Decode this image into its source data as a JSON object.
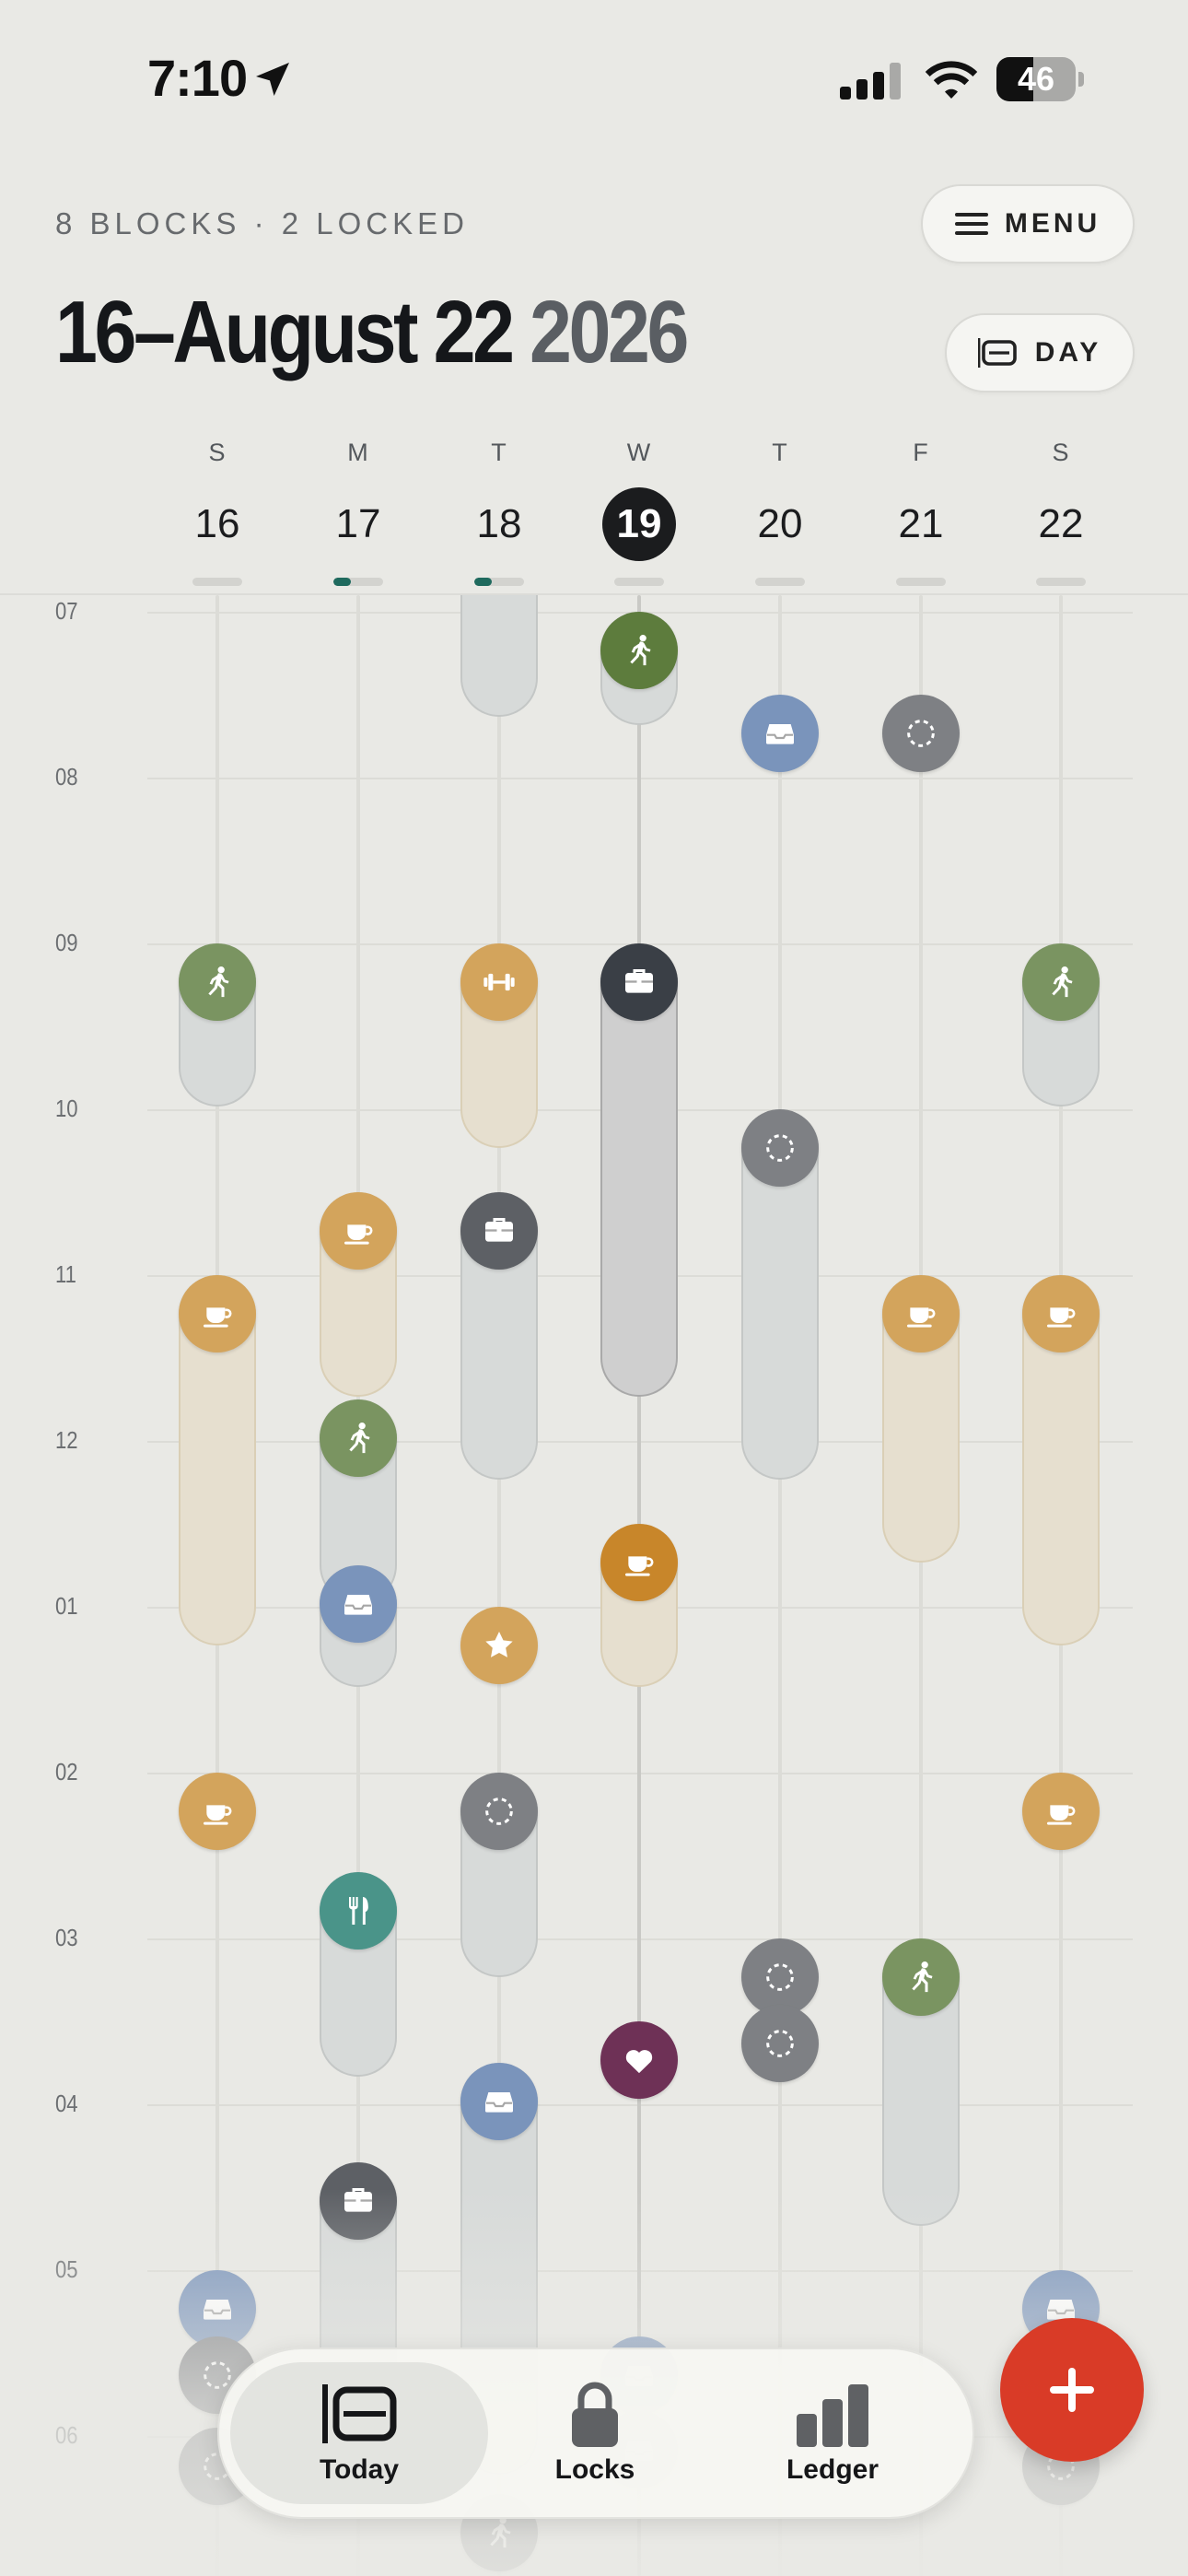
{
  "status_bar": {
    "time": "7:10",
    "battery": "46",
    "battery_level": 0.46
  },
  "header": {
    "subtitle": "8 BLOCKS · 2 LOCKED",
    "title_range": "16–August 22",
    "title_year": "2026",
    "menu_label": "MENU",
    "view_label": "DAY"
  },
  "week": {
    "days": [
      {
        "dow": "S",
        "num": "16",
        "progress": 0
      },
      {
        "dow": "M",
        "num": "17",
        "progress": 0.35
      },
      {
        "dow": "T",
        "num": "18",
        "progress": 0.35
      },
      {
        "dow": "W",
        "num": "19",
        "progress": 0,
        "active": true
      },
      {
        "dow": "T",
        "num": "20",
        "progress": 0
      },
      {
        "dow": "F",
        "num": "21",
        "progress": 0
      },
      {
        "dow": "S",
        "num": "22",
        "progress": 0
      }
    ]
  },
  "timeline": {
    "hours": [
      "07",
      "08",
      "09",
      "10",
      "11",
      "12",
      "01",
      "02",
      "03",
      "04",
      "05",
      "06"
    ],
    "blocks": [
      {
        "day": 2,
        "start": 6.6,
        "end": 7.4,
        "color": "gray",
        "icon": null
      },
      {
        "day": 3,
        "start": 7.0,
        "end": 7.45,
        "color": "green-d",
        "icon": "runner-icon"
      },
      {
        "day": 4,
        "start": 7.5,
        "end": 7.5,
        "color": "blue",
        "icon": "inbox-icon"
      },
      {
        "day": 5,
        "start": 7.5,
        "end": 7.5,
        "color": "gray",
        "icon": "dashed-circle-icon"
      },
      {
        "day": 0,
        "start": 9.0,
        "end": 9.75,
        "color": "green",
        "icon": "runner-icon"
      },
      {
        "day": 2,
        "start": 9.0,
        "end": 10.0,
        "color": "orange",
        "icon": "dumbbell-icon"
      },
      {
        "day": 3,
        "start": 9.0,
        "end": 11.5,
        "color": "navy",
        "icon": "briefcase-icon",
        "dark": true
      },
      {
        "day": 6,
        "start": 9.0,
        "end": 9.75,
        "color": "green",
        "icon": "runner-icon"
      },
      {
        "day": 4,
        "start": 10.0,
        "end": 12.0,
        "color": "gray",
        "icon": "dashed-circle-icon"
      },
      {
        "day": 1,
        "start": 10.5,
        "end": 11.5,
        "color": "orange",
        "icon": "coffee-icon"
      },
      {
        "day": 2,
        "start": 10.5,
        "end": 12.0,
        "color": "slate",
        "icon": "briefcase-icon"
      },
      {
        "day": 0,
        "start": 11.0,
        "end": 13.0,
        "color": "orange",
        "icon": "coffee-icon"
      },
      {
        "day": 5,
        "start": 11.0,
        "end": 12.5,
        "color": "orange",
        "icon": "coffee-icon"
      },
      {
        "day": 6,
        "start": 11.0,
        "end": 13.0,
        "color": "orange",
        "icon": "coffee-icon"
      },
      {
        "day": 1,
        "start": 11.75,
        "end": 12.75,
        "color": "green",
        "icon": "runner-icon"
      },
      {
        "day": 3,
        "start": 12.5,
        "end": 13.25,
        "color": "orange-d",
        "icon": "coffee-icon"
      },
      {
        "day": 1,
        "start": 12.75,
        "end": 13.25,
        "color": "blue",
        "icon": "inbox-icon"
      },
      {
        "day": 2,
        "start": 13.0,
        "end": 13.0,
        "color": "orange",
        "icon": "star-icon"
      },
      {
        "day": 0,
        "start": 14.0,
        "end": 14.0,
        "color": "orange",
        "icon": "coffee-icon"
      },
      {
        "day": 2,
        "start": 14.0,
        "end": 15.0,
        "color": "gray",
        "icon": "dashed-circle-icon"
      },
      {
        "day": 6,
        "start": 14.0,
        "end": 14.0,
        "color": "orange",
        "icon": "coffee-icon"
      },
      {
        "day": 1,
        "start": 14.6,
        "end": 15.6,
        "color": "teal",
        "icon": "utensils-icon"
      },
      {
        "day": 4,
        "start": 15.0,
        "end": 15.0,
        "color": "gray",
        "icon": "dashed-circle-icon"
      },
      {
        "day": 5,
        "start": 15.0,
        "end": 16.5,
        "color": "green",
        "icon": "runner-icon"
      },
      {
        "day": 4,
        "start": 15.4,
        "end": 15.4,
        "color": "gray",
        "icon": "dashed-circle-icon"
      },
      {
        "day": 3,
        "start": 15.5,
        "end": 15.5,
        "color": "plum",
        "icon": "heart-icon"
      },
      {
        "day": 2,
        "start": 15.75,
        "end": 18.0,
        "color": "blue",
        "icon": "inbox-icon"
      },
      {
        "day": 1,
        "start": 16.35,
        "end": 18.0,
        "color": "slate",
        "icon": "briefcase-icon"
      },
      {
        "day": 0,
        "start": 17.0,
        "end": 17.0,
        "color": "blue",
        "icon": "inbox-icon"
      },
      {
        "day": 6,
        "start": 17.0,
        "end": 17.0,
        "color": "blue",
        "icon": "inbox-icon"
      },
      {
        "day": 0,
        "start": 17.4,
        "end": 17.4,
        "color": "gray",
        "icon": "dashed-circle-icon"
      },
      {
        "day": 3,
        "start": 17.4,
        "end": 17.4,
        "color": "blue",
        "icon": "inbox-icon"
      },
      {
        "day": 0,
        "start": 17.95,
        "end": 17.95,
        "color": "gray",
        "icon": "dashed-circle-icon"
      },
      {
        "day": 6,
        "start": 17.95,
        "end": 17.95,
        "color": "gray",
        "icon": "dashed-circle-icon"
      },
      {
        "day": 3,
        "start": 17.85,
        "end": 17.85,
        "color": "blue",
        "icon": "inbox-icon"
      },
      {
        "day": 2,
        "start": 18.35,
        "end": 18.35,
        "color": "gray",
        "icon": "runner-icon"
      }
    ]
  },
  "tabbar": {
    "tabs": [
      {
        "label": "Today",
        "icon": "today-icon",
        "active": true
      },
      {
        "label": "Locks",
        "icon": "lock-icon"
      },
      {
        "label": "Ledger",
        "icon": "bar-chart-icon"
      }
    ],
    "add_icon": "plus-icon"
  },
  "colors": {
    "accent_red": "#d93b27",
    "today_dark": "#1b1c1e",
    "progress_teal": "#1f6a5e"
  }
}
